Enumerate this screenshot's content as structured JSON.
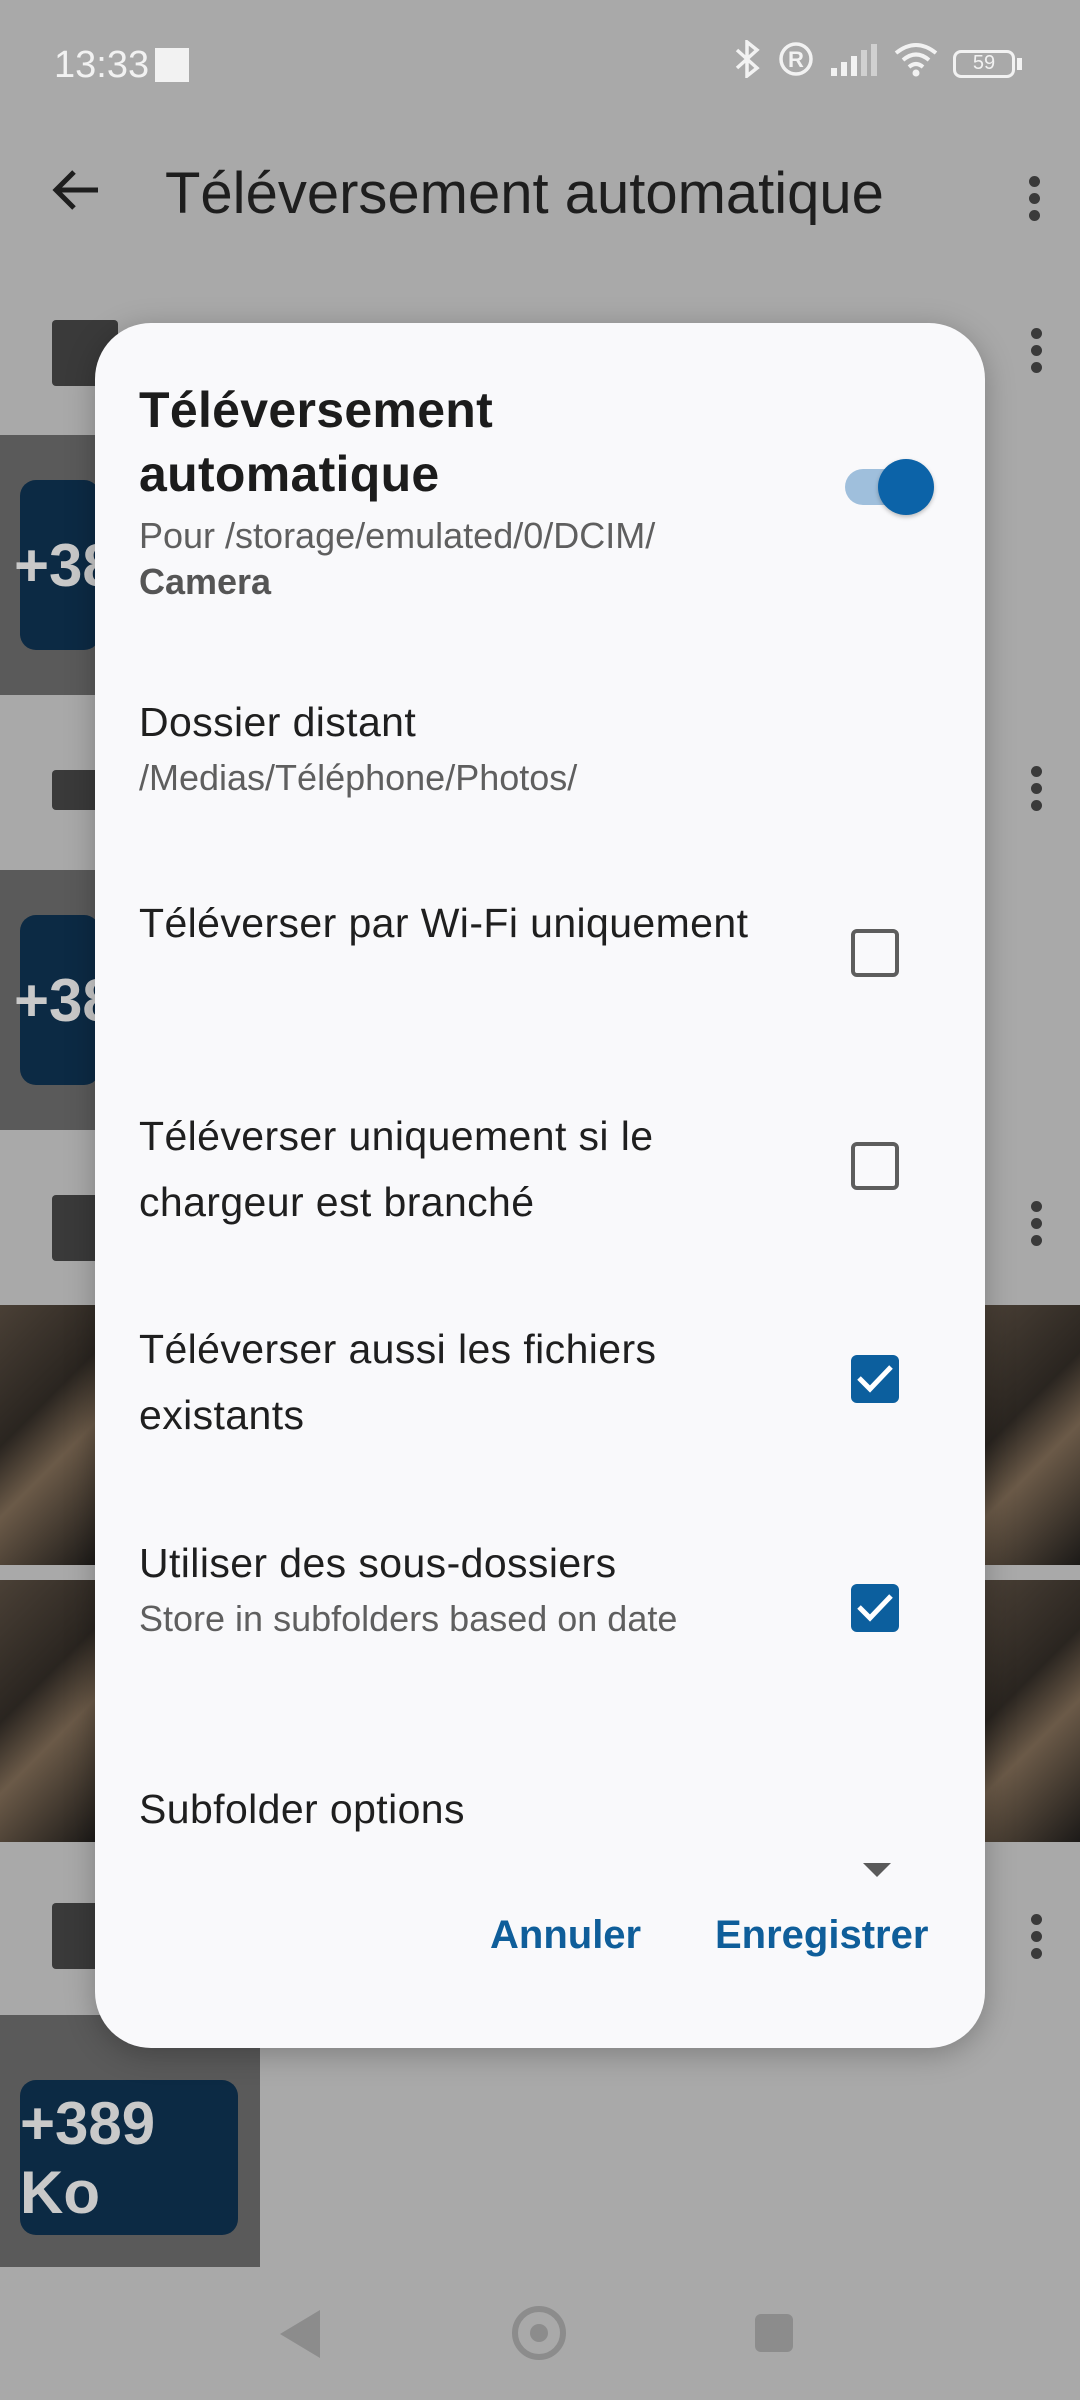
{
  "status_bar": {
    "time": "13:33",
    "battery": "59"
  },
  "app_bar": {
    "title": "Téléversement automatique"
  },
  "background": {
    "folder_sizes": [
      "+38",
      "+38",
      "+389 Ko"
    ]
  },
  "dialog": {
    "title": "Téléversement automatique",
    "subtitle_prefix": "Pour /storage/emulated/0/DCIM/",
    "subtitle_bold": "Camera",
    "toggle_on": true,
    "remote_folder": {
      "title": "Dossier distant",
      "value": "/Medias/Téléphone/Photos/"
    },
    "options": [
      {
        "label": "Téléverser par Wi-Fi uniquement",
        "checked": false
      },
      {
        "label": "Téléverser uniquement si le chargeur est branché",
        "checked": false
      },
      {
        "label": "Téléverser aussi les fichiers existants",
        "checked": true
      },
      {
        "label": "Utiliser des sous-dossiers",
        "sublabel": "Store in subfolders based on date",
        "checked": true
      }
    ],
    "subfolder_options": {
      "title": "Subfolder options"
    },
    "buttons": {
      "cancel": "Annuler",
      "save": "Enregistrer"
    }
  },
  "colors": {
    "accent": "#0c5f9e",
    "toggle_thumb": "#0c63a8",
    "scrim": "#a9a9a9"
  }
}
